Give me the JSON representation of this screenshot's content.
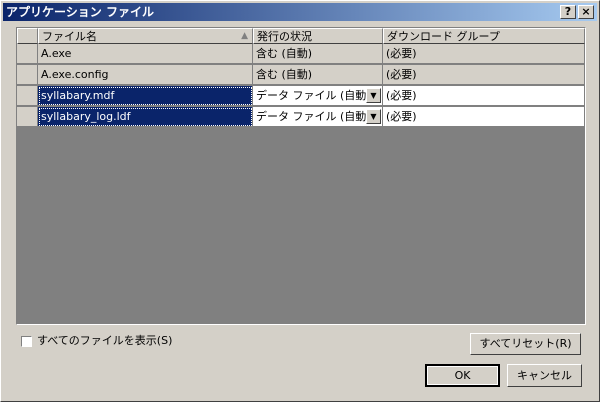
{
  "window": {
    "title": "アプリケーション ファイル",
    "help": "?",
    "close": "×"
  },
  "grid": {
    "columns": [
      "ファイル名",
      "発行の状況",
      "ダウンロード グループ"
    ],
    "rows": [
      {
        "name": "A.exe",
        "status": "含む (自動)",
        "group": "(必要)"
      },
      {
        "name": "A.exe.config",
        "status": "含む (自動)",
        "group": "(必要)"
      },
      {
        "name": "syllabary.mdf",
        "status": "データ ファイル (自動)",
        "group": "(必要)"
      },
      {
        "name": "syllabary_log.ldf",
        "status": "データ ファイル (自動)",
        "group": "(必要)"
      }
    ]
  },
  "footer": {
    "show_all_label": "すべてのファイルを表示(S)",
    "reset_label": "すべてリセット(R)",
    "ok_label": "OK",
    "cancel_label": "キャンセル"
  },
  "colors": {
    "dialog": "#d4d0c8",
    "selection": "#0a246a",
    "grid_empty": "#808080"
  }
}
